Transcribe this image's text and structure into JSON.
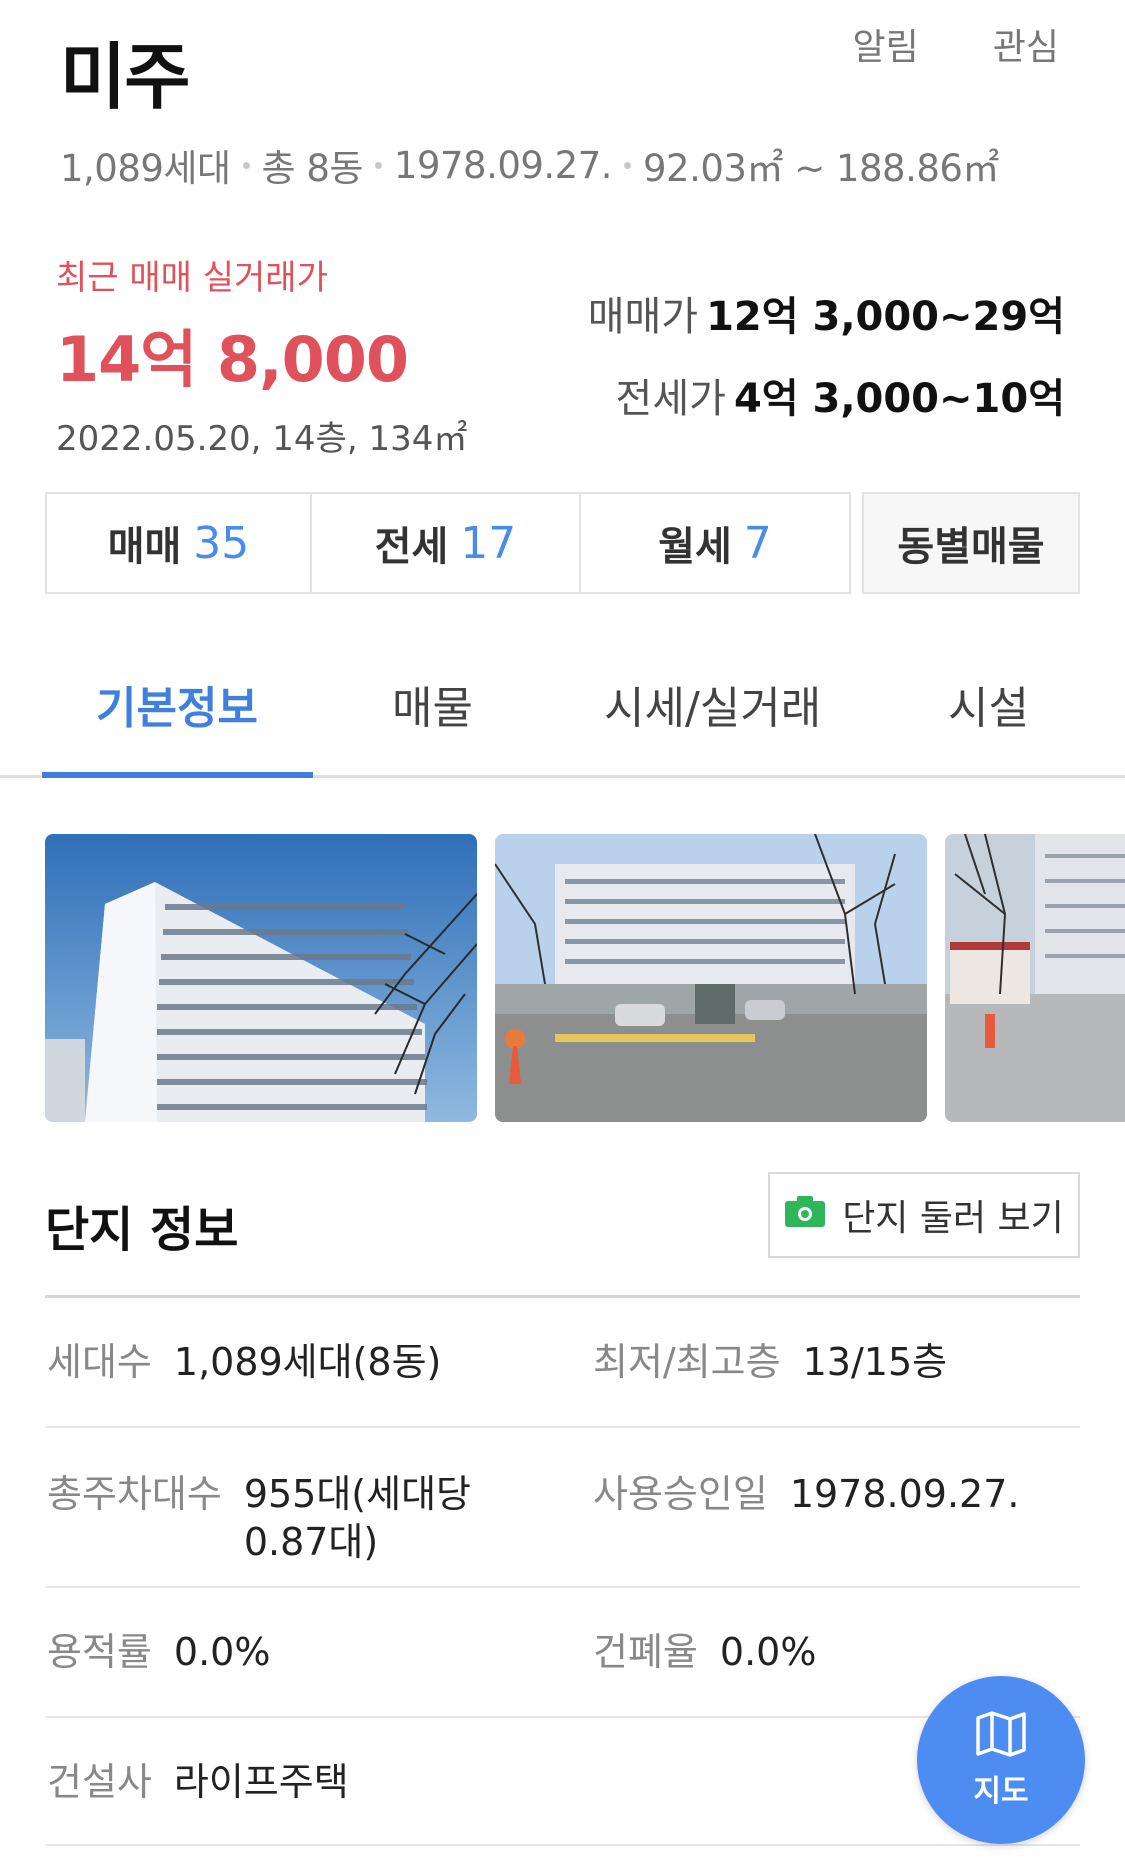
{
  "header": {
    "title": "미주",
    "alert_label": "알림",
    "favorite_label": "관심",
    "households": "1,089세대",
    "buildings": "총 8동",
    "approval_date": "1978.09.27.",
    "area_range": "92.03㎡ ~ 188.86㎡"
  },
  "price": {
    "recent_label": "최근 매매 실거래가",
    "recent_price": "14억 8,000",
    "recent_detail": "2022.05.20, 14층, 134㎡",
    "sale_label": "매매가",
    "sale_range": "12억 3,000~29억",
    "jeonse_label": "전세가",
    "jeonse_range": "4억 3,000~10억"
  },
  "listing_counts": [
    {
      "label": "매매",
      "count": "35"
    },
    {
      "label": "전세",
      "count": "17"
    },
    {
      "label": "월세",
      "count": "7"
    }
  ],
  "by_building_label": "동별매물",
  "tabs": [
    {
      "label": "기본정보",
      "active": true
    },
    {
      "label": "매물",
      "active": false
    },
    {
      "label": "시세/실거래",
      "active": false
    },
    {
      "label": "시설",
      "active": false
    }
  ],
  "complex_info": {
    "title": "단지 정보",
    "tour_label": "단지 둘러 보기",
    "rows": [
      [
        {
          "label": "세대수",
          "value": "1,089세대(8동)"
        },
        {
          "label": "최저/최고층",
          "value": "13/15층"
        }
      ],
      [
        {
          "label": "총주차대수",
          "value": "955대(세대당 0.87대)"
        },
        {
          "label": "사용승인일",
          "value": "1978.09.27."
        }
      ],
      [
        {
          "label": "용적률",
          "value": "0.0%"
        },
        {
          "label": "건폐율",
          "value": "0.0%"
        }
      ],
      [
        {
          "label": "건설사",
          "value": "라이프주택"
        }
      ]
    ]
  },
  "map_button_label": "지도",
  "colors": {
    "accent_blue": "#3f7fe0",
    "price_red": "#e0525b",
    "map_button": "#4d8df2",
    "camera_green": "#2fb65a"
  },
  "icons": [
    "camera-icon",
    "map-icon"
  ]
}
